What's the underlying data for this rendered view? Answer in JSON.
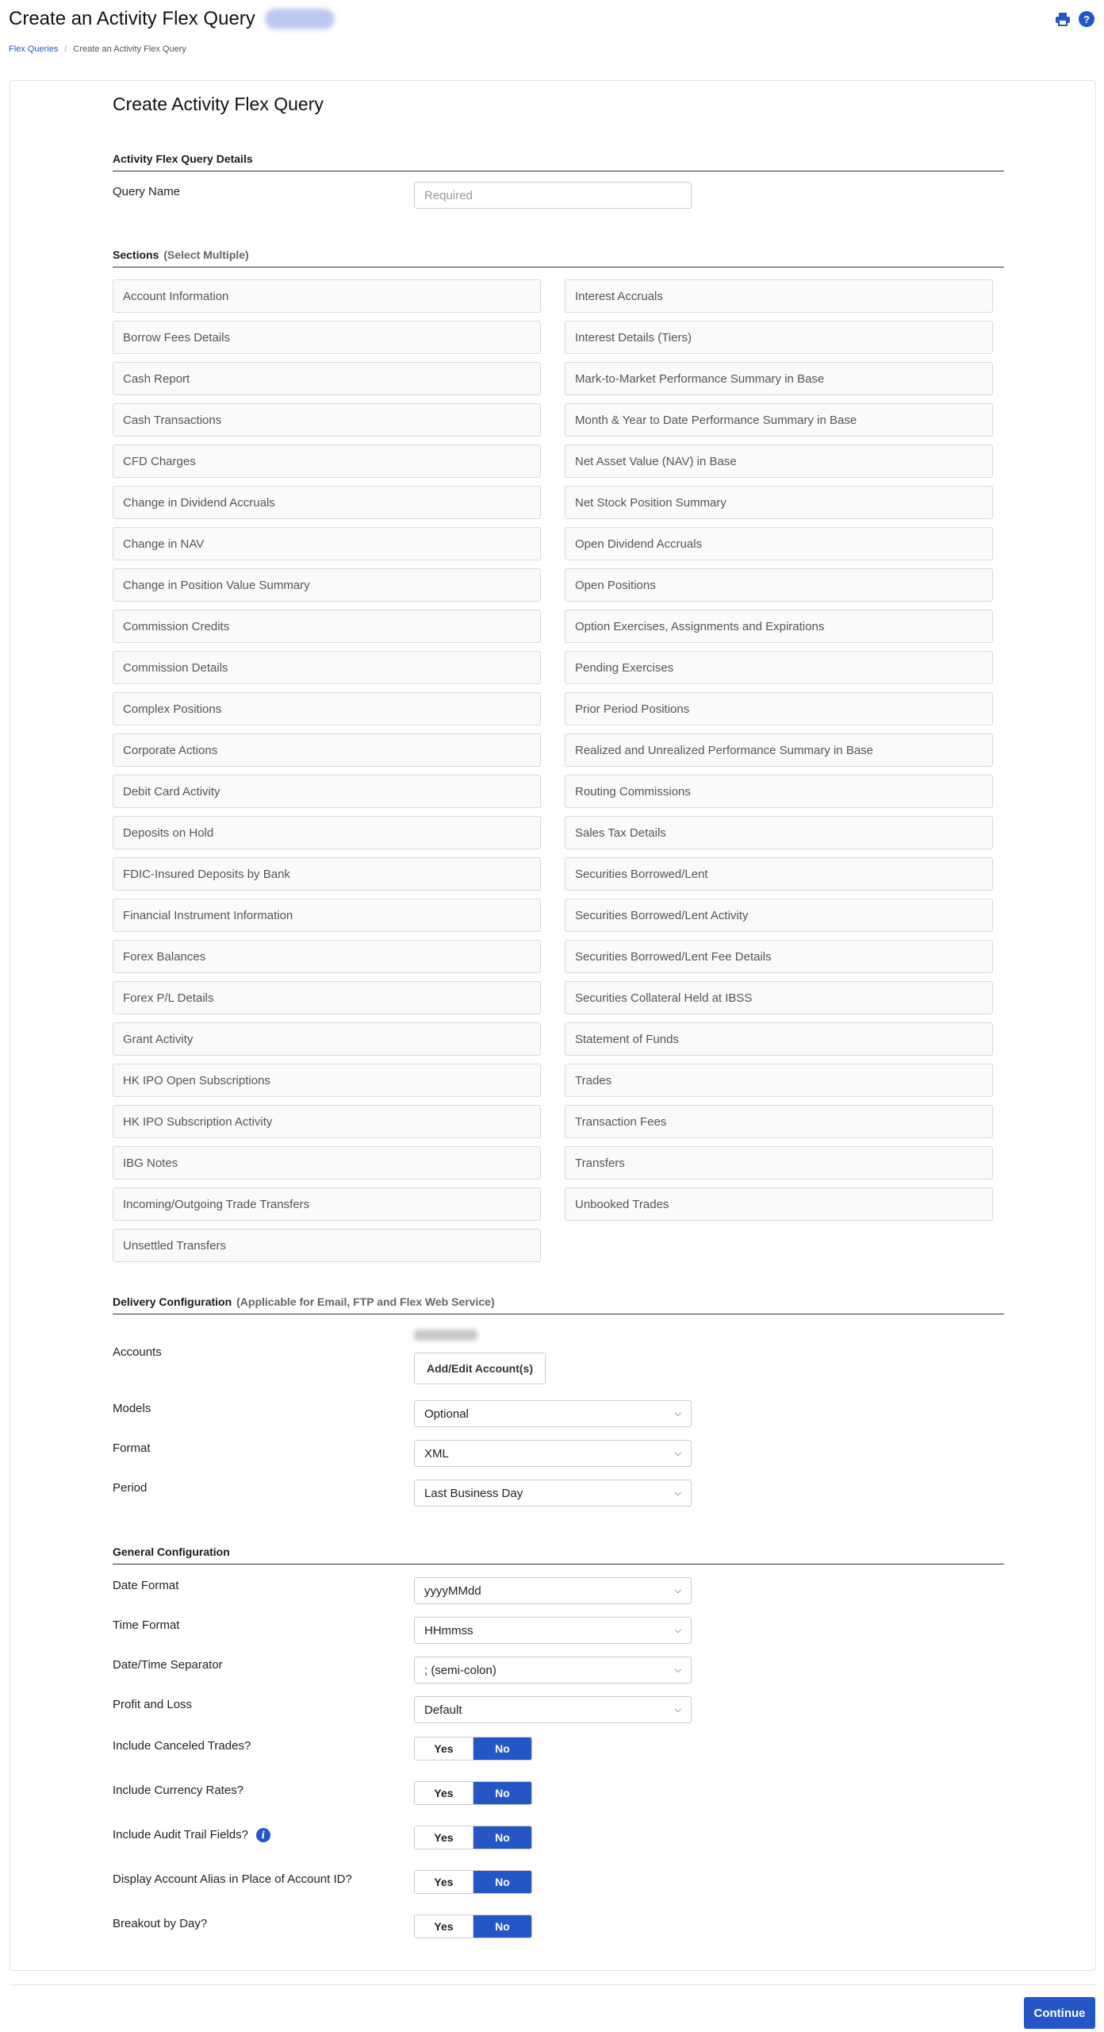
{
  "header": {
    "title": "Create an Activity Flex Query",
    "icons": [
      "printer-icon",
      "help-icon"
    ],
    "help_glyph": "?"
  },
  "breadcrumb": {
    "items": [
      "Flex Queries",
      "Create an Activity Flex Query"
    ],
    "separator": "/"
  },
  "form": {
    "title": "Create Activity Flex Query",
    "details": {
      "heading": "Activity Flex Query Details",
      "query_name_label": "Query Name",
      "query_name_value": "",
      "query_name_placeholder": "Required"
    },
    "sections": {
      "heading": "Sections",
      "subheading": "(Select Multiple)",
      "left": [
        "Account Information",
        "Borrow Fees Details",
        "Cash Report",
        "Cash Transactions",
        "CFD Charges",
        "Change in Dividend Accruals",
        "Change in NAV",
        "Change in Position Value Summary",
        "Commission Credits",
        "Commission Details",
        "Complex Positions",
        "Corporate Actions",
        "Debit Card Activity",
        "Deposits on Hold",
        "FDIC-Insured Deposits by Bank",
        "Financial Instrument Information",
        "Forex Balances",
        "Forex P/L Details",
        "Grant Activity",
        "HK IPO Open Subscriptions",
        "HK IPO Subscription Activity",
        "IBG Notes",
        "Incoming/Outgoing Trade Transfers",
        "Unsettled Transfers"
      ],
      "right": [
        "Interest Accruals",
        "Interest Details (Tiers)",
        "Mark-to-Market Performance Summary in Base",
        "Month & Year to Date Performance Summary in Base",
        "Net Asset Value (NAV) in Base",
        "Net Stock Position Summary",
        "Open Dividend Accruals",
        "Open Positions",
        "Option Exercises, Assignments and Expirations",
        "Pending Exercises",
        "Prior Period Positions",
        "Realized and Unrealized Performance Summary in Base",
        "Routing Commissions",
        "Sales Tax Details",
        "Securities Borrowed/Lent",
        "Securities Borrowed/Lent Activity",
        "Securities Borrowed/Lent Fee Details",
        "Securities Collateral Held at IBSS",
        "Statement of Funds",
        "Trades",
        "Transaction Fees",
        "Transfers",
        "Unbooked Trades"
      ]
    },
    "delivery": {
      "heading": "Delivery Configuration",
      "subheading": "(Applicable for Email, FTP and Flex Web Service)",
      "accounts_label": "Accounts",
      "add_edit_label": "Add/Edit Account(s)",
      "models_label": "Models",
      "models_value": "Optional",
      "format_label": "Format",
      "format_value": "XML",
      "period_label": "Period",
      "period_value": "Last Business Day"
    },
    "general": {
      "heading": "General Configuration",
      "date_format_label": "Date Format",
      "date_format_value": "yyyyMMdd",
      "time_format_label": "Time Format",
      "time_format_value": "HHmmss",
      "separator_label": "Date/Time Separator",
      "separator_value": "; (semi-colon)",
      "pnl_label": "Profit and Loss",
      "pnl_value": "Default",
      "toggles": [
        {
          "label": "Include Canceled Trades?",
          "value": "No",
          "info": false
        },
        {
          "label": "Include Currency Rates?",
          "value": "No",
          "info": false
        },
        {
          "label": "Include Audit Trail Fields?",
          "value": "No",
          "info": true
        },
        {
          "label": "Display Account Alias in Place of Account ID?",
          "value": "No",
          "info": false
        },
        {
          "label": "Breakout by Day?",
          "value": "No",
          "info": false
        }
      ],
      "yes_label": "Yes",
      "no_label": "No",
      "info_glyph": "i"
    }
  },
  "footer": {
    "continue_label": "Continue"
  },
  "colors": {
    "accent": "#2457c5"
  }
}
